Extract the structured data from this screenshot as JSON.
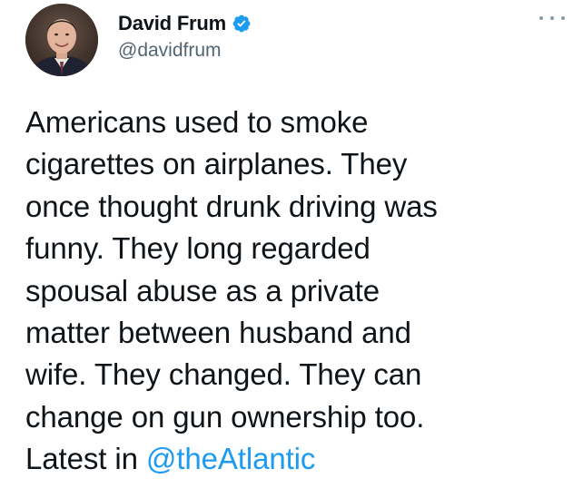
{
  "author": {
    "display_name": "David Frum",
    "handle": "@davidfrum",
    "verified": true
  },
  "tweet": {
    "lines": [
      "Americans used to smoke",
      "cigarettes on airplanes. They",
      "once thought drunk driving was",
      "funny. They long regarded",
      "spousal abuse as a private",
      "matter between husband and",
      "wife. They changed. They can",
      "change on gun ownership too."
    ],
    "last_line_prefix": "Latest in ",
    "mention": "@theAtlantic"
  },
  "icons": {
    "verified": "verified-badge-icon",
    "more": "more-options-icon"
  },
  "colors": {
    "verified_blue": "#1d9bf0",
    "mention_blue": "#1d9bf0",
    "handle_gray": "#536471",
    "text": "#0f1419"
  }
}
